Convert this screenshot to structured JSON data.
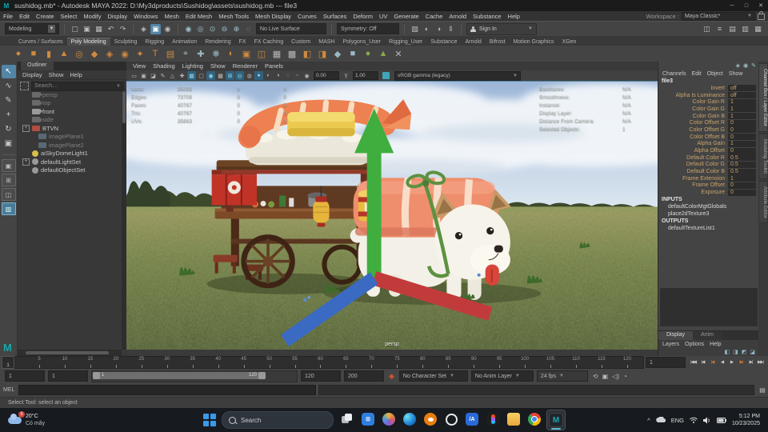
{
  "window": {
    "app_badge": "M",
    "title": "sushidog.mb* - Autodesk MAYA 2022: D:\\My3dproducts\\Sushidog\\assets\\sushidog.mb  ---  file3",
    "controls": [
      {
        "g": "─",
        "name": "minimize"
      },
      {
        "g": "□",
        "name": "maximize"
      },
      {
        "g": "✕",
        "name": "close"
      }
    ]
  },
  "menu_bar": {
    "items": [
      "File",
      "Edit",
      "Create",
      "Select",
      "Modify",
      "Display",
      "Windows",
      "Mesh",
      "Edit Mesh",
      "Mesh Tools",
      "Mesh Display",
      "Curves",
      "Surfaces",
      "Deform",
      "UV",
      "Generate",
      "Cache",
      "Arnold",
      "Substance",
      "Help"
    ],
    "workspace_label": "Workspace :",
    "workspace_value": "Maya Classic*"
  },
  "status_line": {
    "mode": "Modeling",
    "file_icons": [
      {
        "g": "▢",
        "name": "new-scene"
      },
      {
        "g": "▣",
        "name": "open-scene"
      },
      {
        "g": "▦",
        "name": "save-scene"
      },
      {
        "g": "↶",
        "name": "undo"
      },
      {
        "g": "↷",
        "name": "redo"
      }
    ],
    "mask_icons": [
      {
        "g": "◈",
        "name": "select-hierarchy"
      },
      {
        "g": "▣",
        "cls": "on",
        "name": "select-object"
      },
      {
        "g": "◉",
        "name": "select-component"
      }
    ],
    "snap_icons": [
      {
        "g": "◉",
        "name": "snap-grid"
      },
      {
        "g": "◎",
        "name": "snap-curve"
      },
      {
        "g": "⊙",
        "name": "snap-point"
      },
      {
        "g": "⊖",
        "name": "snap-projected"
      },
      {
        "g": "⊕",
        "name": "snap-view"
      },
      {
        "g": "◌",
        "name": "make-live"
      }
    ],
    "live_surface": "No Live Surface",
    "symmetry": "Symmetry: Off",
    "render_icons": [
      {
        "g": "▧",
        "name": "render-frame"
      },
      {
        "g": "◐",
        "name": "ipr-render"
      },
      {
        "g": "◑",
        "name": "render-settings"
      },
      {
        "g": "‖",
        "name": "pause"
      }
    ],
    "sign_in": "Sign In",
    "right_icons": [
      {
        "g": "◫",
        "name": "modeling-toolkit-toggle"
      },
      {
        "g": "≡",
        "name": "hypershade-toggle"
      },
      {
        "g": "▤",
        "name": "tool-settings-toggle"
      },
      {
        "g": "▥",
        "name": "attribute-editor-toggle"
      },
      {
        "g": "▦",
        "name": "channel-box-toggle"
      }
    ]
  },
  "shelf": {
    "tabs": [
      {
        "label": "Curves / Surfaces"
      },
      {
        "label": "Poly Modeling",
        "cls": "active"
      },
      {
        "label": "Sculpting"
      },
      {
        "label": "Rigging"
      },
      {
        "label": "Animation"
      },
      {
        "label": "Rendering"
      },
      {
        "label": "FX"
      },
      {
        "label": "FX Caching"
      },
      {
        "label": "Custom"
      },
      {
        "label": "MASH"
      },
      {
        "label": "Polygons_User"
      },
      {
        "label": "Rigging_User"
      },
      {
        "label": "Substance"
      },
      {
        "label": "Arnold"
      },
      {
        "label": "Bifrost"
      },
      {
        "label": "Motion Graphics"
      },
      {
        "label": "XGen"
      }
    ],
    "icons": [
      {
        "g": "●",
        "c": "#d08a3e",
        "name": "poly-sphere"
      },
      {
        "g": "■",
        "c": "#d08a3e",
        "name": "poly-cube"
      },
      {
        "g": "▮",
        "c": "#d08a3e",
        "name": "poly-cylinder"
      },
      {
        "g": "▲",
        "c": "#d08a3e",
        "name": "poly-cone"
      },
      {
        "g": "◎",
        "c": "#d08a3e",
        "name": "poly-torus"
      },
      {
        "g": "◆",
        "c": "#d08a3e",
        "name": "poly-plane"
      },
      {
        "g": "◈",
        "c": "#d08a3e",
        "name": "poly-disc"
      },
      {
        "g": "◉",
        "c": "#d08a3e",
        "name": "platonic-solid"
      },
      {
        "g": "✦",
        "c": "#d08a3e",
        "name": "super-shape"
      },
      {
        "g": "T",
        "c": "#d08a3e",
        "name": "type-tool"
      },
      {
        "g": "▤",
        "c": "#d08a3e",
        "name": "svg-tool"
      },
      {
        "g": "⌖",
        "c": "#9ab8c4",
        "name": "construction-plane"
      },
      {
        "g": "✚",
        "c": "#9ab8c4",
        "name": "add-divisions"
      },
      {
        "g": "❋",
        "c": "#9ab8c4",
        "name": "multi-cut"
      },
      {
        "g": "◐",
        "c": "#d08a3e",
        "name": "combine"
      },
      {
        "g": "▣",
        "c": "#d08a3e",
        "name": "separate"
      },
      {
        "g": "◫",
        "c": "#d08a3e",
        "name": "boolean-union"
      },
      {
        "g": "▦",
        "c": "#b8b8b8",
        "name": "boolean-difference"
      },
      {
        "g": "▩",
        "c": "#b8b8b8",
        "name": "boolean-intersect"
      },
      {
        "g": "◧",
        "c": "#d08a3e",
        "name": "extrude"
      },
      {
        "g": "◨",
        "c": "#d08a3e",
        "name": "bevel"
      },
      {
        "g": "◆",
        "c": "#9ab8c4",
        "name": "bridge"
      },
      {
        "g": "■",
        "c": "#9ab8c4",
        "name": "fill-hole"
      },
      {
        "g": "●",
        "c": "#8aa84a",
        "name": "smooth"
      },
      {
        "g": "▲",
        "c": "#8aa84a",
        "name": "mirror"
      },
      {
        "g": "✕",
        "c": "#b8b8b8",
        "name": "delete-edge"
      }
    ]
  },
  "toolbox": {
    "tools": [
      {
        "g": "↖",
        "cls": "active",
        "name": "select"
      },
      {
        "g": "∿",
        "name": "lasso"
      },
      {
        "g": "✎",
        "name": "paint-select"
      },
      {
        "g": "+",
        "name": "move"
      },
      {
        "g": "↻",
        "name": "rotate"
      },
      {
        "g": "▣",
        "name": "scale"
      }
    ],
    "layouts": [
      {
        "g": "▣",
        "name": "single-pane"
      },
      {
        "g": "⊞",
        "name": "four-pane"
      },
      {
        "g": "◫",
        "name": "two-pane"
      },
      {
        "g": "▥",
        "cls": "active",
        "name": "outliner-persp"
      }
    ]
  },
  "outliner": {
    "tab": "Outliner",
    "menus": [
      "Display",
      "Show",
      "Help"
    ],
    "search_placeholder": "Search...",
    "items": [
      {
        "label": "persp",
        "icon": "camera",
        "cls": "dim"
      },
      {
        "label": "top",
        "icon": "camera",
        "cls": "dim"
      },
      {
        "label": "front",
        "icon": "camera"
      },
      {
        "label": "side",
        "icon": "camera",
        "cls": "dim"
      },
      {
        "label": "BTVN",
        "icon": "mesh",
        "cls": "expand"
      },
      {
        "label": "imagePlane1",
        "icon": "imageplane",
        "cls": "dim ind1"
      },
      {
        "label": "imagePlane2",
        "icon": "imageplane",
        "cls": "dim ind1"
      },
      {
        "label": "aiSkyDomeLight1",
        "icon": "skydome"
      },
      {
        "label": "defaultLightSet",
        "icon": "set",
        "cls": "expand"
      },
      {
        "label": "defaultObjectSet",
        "icon": "set"
      }
    ]
  },
  "viewport": {
    "menus": [
      "View",
      "Shading",
      "Lighting",
      "Show",
      "Renderer",
      "Panels"
    ],
    "toolbar_icons": [
      {
        "g": "▭"
      },
      {
        "g": "▣"
      },
      {
        "g": "◪"
      },
      {
        "g": "✎"
      },
      {
        "g": "△"
      },
      {
        "g": "✚"
      },
      {
        "g": "▦",
        "cls": "on"
      },
      {
        "g": "▢"
      },
      {
        "g": "◉",
        "cls": "on"
      },
      {
        "g": "▩"
      },
      {
        "g": "⊞",
        "cls": "on"
      },
      {
        "g": "◎",
        "cls": "on"
      },
      {
        "g": "◍"
      },
      {
        "g": "●",
        "cls": "on"
      },
      {
        "g": "◐"
      },
      {
        "g": "◑"
      },
      {
        "g": "◌"
      },
      {
        "g": "▫"
      }
    ],
    "exposure": "0.00",
    "gamma": "1.00",
    "color_space": "sRGB gamma (legacy)",
    "camera_label": "persp",
    "hud_left": [
      {
        "label": "Verts:",
        "a": "35083",
        "b": "0",
        "c": "0"
      },
      {
        "label": "Edges:",
        "a": "73709",
        "b": "0",
        "c": "0"
      },
      {
        "label": "Faces:",
        "a": "40767",
        "b": "0",
        "c": "0"
      },
      {
        "label": "Tris:",
        "a": "40767",
        "b": "0",
        "c": "0"
      },
      {
        "label": "UVs:",
        "a": "35863",
        "b": "0",
        "c": "0"
      }
    ],
    "hud_right": [
      {
        "label": "Backfaces:",
        "value": "N/A"
      },
      {
        "label": "Smoothness:",
        "value": "N/A"
      },
      {
        "label": "Instance:",
        "value": "N/A"
      },
      {
        "label": "Display Layer:",
        "value": "N/A"
      },
      {
        "label": "Distance From Camera:",
        "value": "N/A"
      },
      {
        "label": "Selected Objects:",
        "value": "1"
      }
    ]
  },
  "channel_box": {
    "top_icons": [
      {
        "g": "◈",
        "name": "pin"
      },
      {
        "g": "◉",
        "name": "speed-state"
      },
      {
        "g": "✎",
        "name": "manipulator"
      }
    ],
    "menus": [
      "Channels",
      "Edit",
      "Object",
      "Show"
    ],
    "node": "file3",
    "attributes": [
      {
        "label": "Invert",
        "value": "off"
      },
      {
        "label": "Alpha Is Luminance",
        "value": "off"
      },
      {
        "label": "Color Gain R",
        "value": "1"
      },
      {
        "label": "Color Gain G",
        "value": "1"
      },
      {
        "label": "Color Gain B",
        "value": "1"
      },
      {
        "label": "Color Offset R",
        "value": "0"
      },
      {
        "label": "Color Offset G",
        "value": "0"
      },
      {
        "label": "Color Offset B",
        "value": "0"
      },
      {
        "label": "Alpha Gain",
        "value": "1"
      },
      {
        "label": "Alpha Offset",
        "value": "0"
      },
      {
        "label": "Default Color R",
        "value": "0.5"
      },
      {
        "label": "Default Color G",
        "value": "0.5"
      },
      {
        "label": "Default Color B",
        "value": "0.5"
      },
      {
        "label": "Frame Extension",
        "value": "1"
      },
      {
        "label": "Frame Offset",
        "value": "0"
      },
      {
        "label": "Exposure",
        "value": "0"
      }
    ],
    "inputs_header": "INPUTS",
    "inputs": [
      "defaultColorMgtGlobals",
      "place2dTexture3"
    ],
    "outputs_header": "OUTPUTS",
    "outputs": [
      "defaultTextureList1"
    ],
    "side_tabs": [
      {
        "label": "Channel Box / Layer Editor",
        "cls": "active"
      },
      {
        "label": "Modeling Toolkit"
      },
      {
        "label": "Attribute Editor"
      }
    ]
  },
  "layer_editor": {
    "tabs": [
      {
        "label": "Display",
        "cls": "active"
      },
      {
        "label": "Anim"
      }
    ],
    "menus": [
      "Layers",
      "Options",
      "Help"
    ],
    "icons": [
      {
        "g": "◧"
      },
      {
        "g": "◨"
      },
      {
        "g": "◩"
      },
      {
        "g": "◪"
      }
    ]
  },
  "timeline": {
    "ticks": [
      "5",
      "10",
      "15",
      "20",
      "25",
      "30",
      "35",
      "40",
      "45",
      "50",
      "55",
      "60",
      "65",
      "70",
      "75",
      "80",
      "85",
      "90",
      "95",
      "100",
      "105",
      "110",
      "115",
      "120"
    ],
    "playhead": "1",
    "current_frame": "1",
    "transport": [
      {
        "g": "|◀◀",
        "name": "go-to-start"
      },
      {
        "g": "|◀",
        "name": "step-back-frame"
      },
      {
        "g": "|◀",
        "cls": "key",
        "name": "step-back-key"
      },
      {
        "g": "◀",
        "name": "play-backwards"
      },
      {
        "g": "▶",
        "name": "play-forwards"
      },
      {
        "g": "▶|",
        "cls": "key",
        "name": "step-forward-key"
      },
      {
        "g": "▶|",
        "name": "step-forward-frame"
      },
      {
        "g": "▶▶|",
        "name": "go-to-end"
      }
    ]
  },
  "range_slider": {
    "anim_start": "1",
    "playback_start": "1",
    "bar_start": "1",
    "bar_end": "120",
    "playback_end": "120",
    "anim_end": "200",
    "character_set": "No Character Set",
    "anim_layer": "No Anim Layer",
    "fps": "24 fps"
  },
  "command_line": {
    "label": "MEL"
  },
  "help_line": {
    "text": "Select Tool: select an object"
  },
  "taskbar": {
    "weather_badge": "9",
    "weather_temp": "20°C",
    "weather_desc": "Có mây",
    "search_placeholder": "Search",
    "apps": [
      {
        "cls": "taskview",
        "name": "task-view"
      },
      {
        "cls": "store",
        "g": "⊞",
        "name": "microsoft-store"
      },
      {
        "cls": "copilot",
        "name": "copilot"
      },
      {
        "cls": "edge",
        "name": "edge"
      },
      {
        "cls": "blender",
        "name": "blender"
      },
      {
        "cls": "alexa",
        "name": "alexa"
      },
      {
        "cls": "medibang",
        "g": "/A",
        "name": "medibang"
      },
      {
        "cls": "figma",
        "name": "figma"
      },
      {
        "cls": "explorer",
        "name": "file-explorer"
      },
      {
        "cls": "chrome",
        "name": "chrome"
      },
      {
        "cls": "maya active",
        "g": "M",
        "name": "maya"
      }
    ],
    "tray_chevron": "^",
    "tray_lang": "ENG",
    "time": "5:12 PM",
    "date": "10/23/2025"
  }
}
